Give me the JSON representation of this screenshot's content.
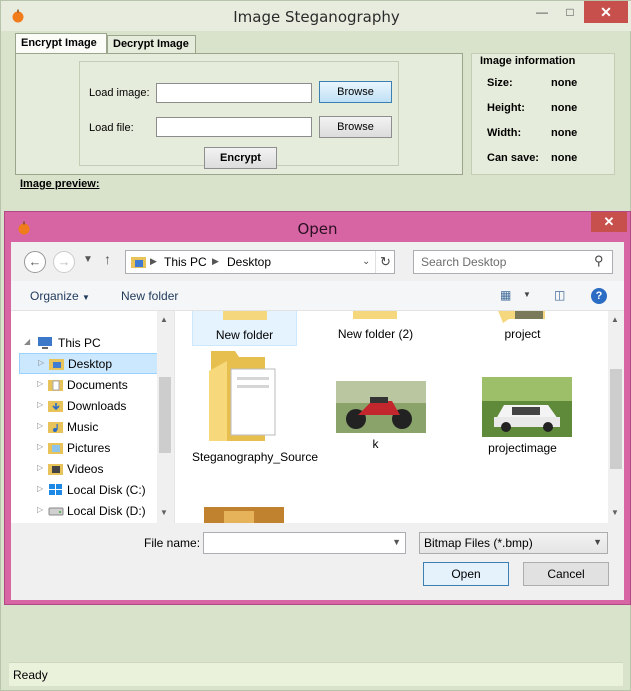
{
  "app": {
    "title": "Image  Steganography",
    "tabs": {
      "encrypt": "Encrypt Image",
      "decrypt": "Decrypt Image"
    },
    "encrypt": {
      "load_image_label": "Load image:",
      "load_file_label": "Load file:",
      "browse1": "Browse",
      "browse2": "Browse",
      "encrypt_button": "Encrypt"
    },
    "info": {
      "legend": "Image information",
      "size_label": "Size:",
      "size_value": "none",
      "height_label": "Height:",
      "height_value": "none",
      "width_label": "Width:",
      "width_value": "none",
      "cansave_label": "Can save:",
      "cansave_value": "none"
    },
    "preview_label": "Image preview:",
    "status": "Ready"
  },
  "dialog": {
    "title": "Open",
    "address": {
      "root": "This PC",
      "current": "Desktop"
    },
    "search_placeholder": "Search Desktop",
    "organize": "Organize",
    "new_folder": "New folder",
    "tree": [
      "This PC",
      "Desktop",
      "Documents",
      "Downloads",
      "Music",
      "Pictures",
      "Videos",
      "Local Disk (C:)",
      "Local Disk (D:)"
    ],
    "files": {
      "newfolder": "New folder",
      "newfolder2": "New folder (2)",
      "project": "project",
      "steg": "Steganography_Source",
      "k": "k",
      "projectimage": "projectimage"
    },
    "filename_label": "File name:",
    "filename_value": "",
    "filetype": "Bitmap Files (*.bmp)",
    "open_button": "Open",
    "cancel_button": "Cancel"
  },
  "colors": {
    "app_bg": "#d9e3cc",
    "dialog_frame": "#d765a4",
    "close_red": "#c7504c",
    "selection": "#cce8ff"
  }
}
